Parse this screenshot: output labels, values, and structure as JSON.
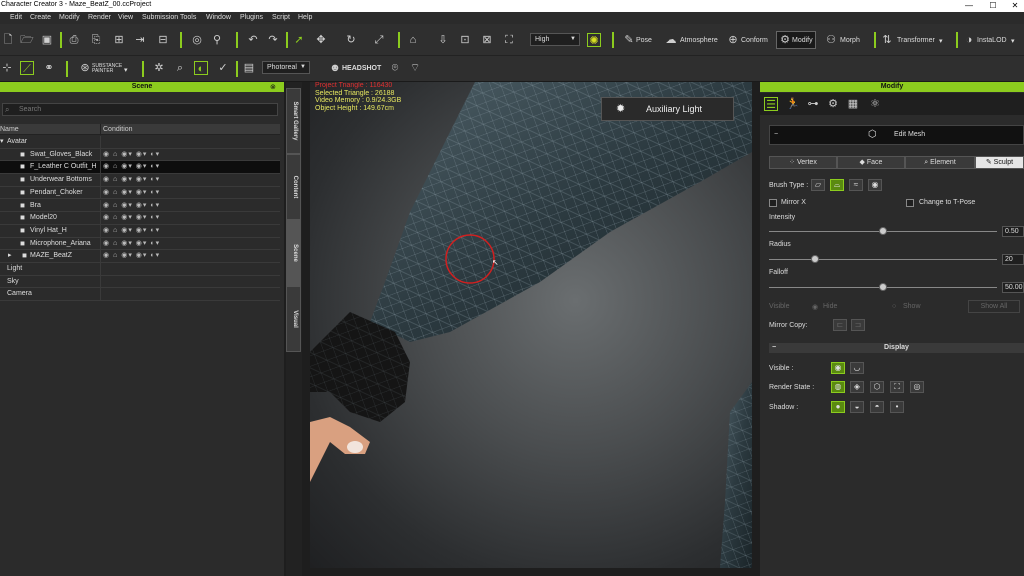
{
  "window": {
    "title": "Character Creator 3 - Maze_BeatZ_00.ccProject",
    "min": "—",
    "max": "☐",
    "close": "✕"
  },
  "menu": [
    "Edit",
    "Create",
    "Modify",
    "Render",
    "View",
    "Submission Tools",
    "Window",
    "Plugins",
    "Script",
    "Help"
  ],
  "toolbar": {
    "quality": "High",
    "pose": "Pose",
    "atmosphere": "Atmosphere",
    "conform": "Conform",
    "modify": "Modify",
    "morph": "Morph",
    "transformer": "Transformer",
    "instalod": "InstaLOD",
    "substance": "SUBSTANCE PAINTER",
    "render_mode": "Photoreal",
    "headshot": "HEADSHOT"
  },
  "scene": {
    "title": "Scene",
    "search_placeholder": "Search",
    "col_name": "Name",
    "col_condition": "Condition",
    "rows": [
      {
        "name": "Avatar",
        "indent": 0,
        "cond": false,
        "sel": false,
        "expand": "▾"
      },
      {
        "name": "Swat_Gloves_Black",
        "indent": 2,
        "cond": true,
        "sel": false,
        "expand": ""
      },
      {
        "name": "F_Leather C Outfit_H",
        "indent": 2,
        "cond": true,
        "sel": true,
        "expand": ""
      },
      {
        "name": "Underwear Bottoms",
        "indent": 2,
        "cond": true,
        "sel": false,
        "expand": ""
      },
      {
        "name": "Pendant_Choker",
        "indent": 2,
        "cond": true,
        "sel": false,
        "expand": ""
      },
      {
        "name": "Bra",
        "indent": 2,
        "cond": true,
        "sel": false,
        "expand": ""
      },
      {
        "name": "Model20",
        "indent": 2,
        "cond": true,
        "sel": false,
        "expand": ""
      },
      {
        "name": "Vinyl Hat_H",
        "indent": 2,
        "cond": true,
        "sel": false,
        "expand": ""
      },
      {
        "name": "Microphone_Ariana",
        "indent": 2,
        "cond": true,
        "sel": false,
        "expand": ""
      },
      {
        "name": "MAZE_BeatZ",
        "indent": 1,
        "cond": true,
        "sel": false,
        "expand": "▸"
      },
      {
        "name": "Light",
        "indent": 0,
        "cond": false,
        "sel": false,
        "expand": ""
      },
      {
        "name": "Sky",
        "indent": 0,
        "cond": false,
        "sel": false,
        "expand": ""
      },
      {
        "name": "Camera",
        "indent": 0,
        "cond": false,
        "sel": false,
        "expand": ""
      }
    ],
    "cond_icons": "◉  ⌂ ◉▾ ◉▾ ◐▾"
  },
  "side_tabs": [
    "Smart Gallery",
    "Content",
    "Scene",
    "Visual"
  ],
  "viewport": {
    "info": [
      "Project Triangle : 116430",
      "Selected Triangle : 26188",
      "Video Memory : 0.9/24.3GB",
      "Object Height : 149.67cm"
    ],
    "aux_light": "Auxiliary Light"
  },
  "modify": {
    "title": "Modify",
    "edit_mesh": "Edit Mesh",
    "tabs": [
      "Vertex",
      "Face",
      "Element",
      "Sculpt"
    ],
    "brush_type": "Brush Type :",
    "mirror_x": "Mirror X",
    "change_tpose": "Change to T-Pose",
    "intensity": {
      "label": "Intensity",
      "value": "0.50",
      "level": 0.5
    },
    "radius": {
      "label": "Radius",
      "value": "20",
      "level": 0.2
    },
    "falloff": {
      "label": "Falloff",
      "value": "50.00",
      "level": 0.5
    },
    "visible_row": {
      "label": "Visible",
      "hide": "Hide",
      "show": "Show",
      "btn": "Show All"
    },
    "mirror_copy": "Mirror Copy:",
    "display": "Display",
    "visible": "Visible :",
    "render_state": "Render State :",
    "shadow": "Shadow :"
  },
  "colors": {
    "accent": "#8ccc1e",
    "brush_circle": "#d02020"
  }
}
